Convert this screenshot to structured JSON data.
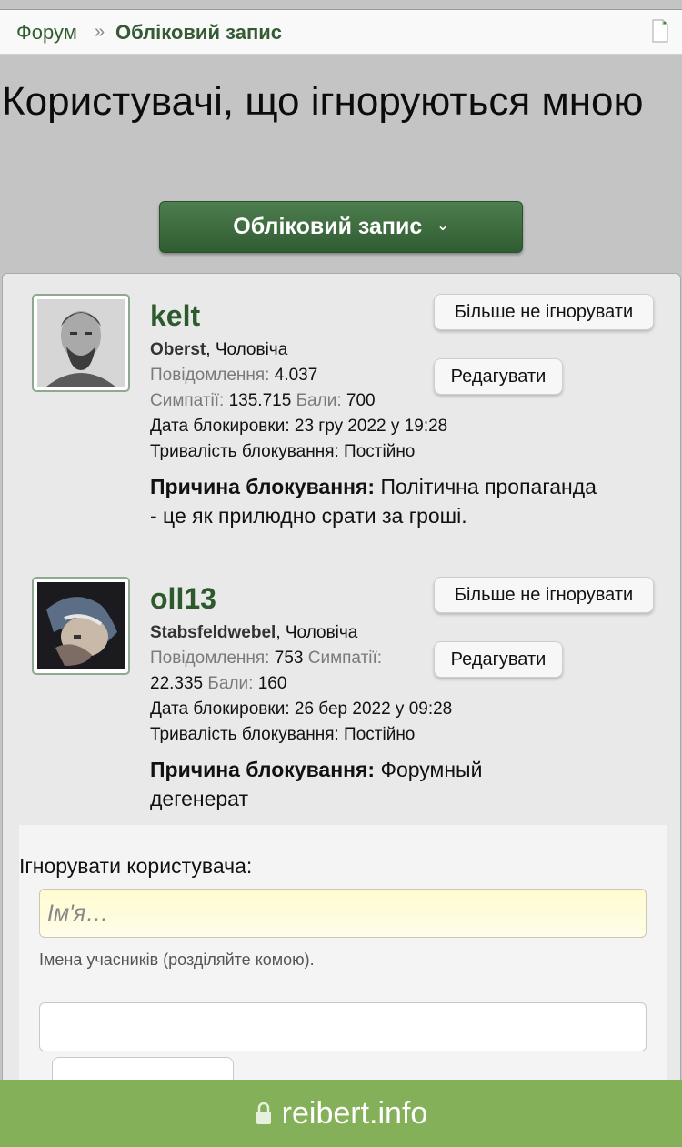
{
  "breadcrumb": {
    "home": "Форум",
    "separator": "»",
    "current": "Обліковий запис"
  },
  "page_title": "Користувачі, що ігноруються мною",
  "account_menu": {
    "label": "Обліковий запис",
    "icon": "chevron-down-icon"
  },
  "users": [
    {
      "name": "kelt",
      "title": "Oberst",
      "gender": "Чоловіча",
      "posts_label": "Повідомлення:",
      "posts": "4.037",
      "likes_label": "Симпатії:",
      "likes": "135.715",
      "points_label": "Бали:",
      "points": "700",
      "block_date": "Дата блокировки: 23 гру 2022 у 19:28",
      "block_duration": "Тривалість блокування: Постійно",
      "reason_label": "Причина блокування:",
      "reason": "Політична пропаганда - це як прилюдно срати за гроші.",
      "unignore_label": "Більше не ігнорувати",
      "edit_label": "Редагувати"
    },
    {
      "name": "oll13",
      "title": "Stabsfeldwebel",
      "gender": "Чоловіча",
      "posts_label": "Повідомлення:",
      "posts": "753",
      "likes_label": "Симпатії:",
      "likes": "22.335",
      "points_label": "Бали:",
      "points": "160",
      "block_date": "Дата блокировки: 26 бер 2022 у 09:28",
      "block_duration": "Тривалість блокування: Постійно",
      "reason_label": "Причина блокування:",
      "reason": "Форумный дегенерат",
      "unignore_label": "Більше не ігнорувати",
      "edit_label": "Редагувати"
    }
  ],
  "ignore_form": {
    "label": "Ігнорувати користувача:",
    "placeholder": "Ім'я…",
    "hint": "Імена учасників (розділяйте комою)."
  },
  "browser": {
    "domain": "reibert.info"
  }
}
